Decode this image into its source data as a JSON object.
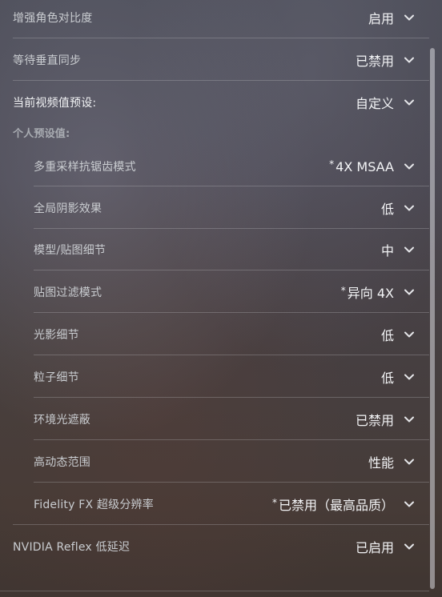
{
  "settings": {
    "enhance_contrast": {
      "label": "增强角色对比度",
      "value": "启用"
    },
    "vsync": {
      "label": "等待垂直同步",
      "value": "已禁用"
    },
    "current_preset": {
      "label": "当前视频值预设:",
      "value": "自定义"
    },
    "custom_section": "个人预设值:",
    "msaa": {
      "label": "多重采样抗锯齿模式",
      "value": "4X MSAA"
    },
    "shadows": {
      "label": "全局阴影效果",
      "value": "低"
    },
    "model_texture": {
      "label": "模型/贴图细节",
      "value": "中"
    },
    "texture_filter": {
      "label": "贴图过滤模式",
      "value": "异向 4X"
    },
    "shader": {
      "label": "光影细节",
      "value": "低"
    },
    "particle": {
      "label": "粒子细节",
      "value": "低"
    },
    "ambient_occlusion": {
      "label": "环境光遮蔽",
      "value": "已禁用"
    },
    "hdr": {
      "label": "高动态范围",
      "value": "性能"
    },
    "fsr": {
      "label": "Fidelity FX 超级分辨率",
      "value": "已禁用（最高品质）"
    },
    "reflex": {
      "label": "NVIDIA Reflex 低延迟",
      "value": "已启用"
    }
  },
  "icons": {
    "dropdown": "chevron-down-icon"
  },
  "colors": {
    "text": "#f3f4f6",
    "label": "#c9ccd0",
    "section": "#a9acb2"
  }
}
